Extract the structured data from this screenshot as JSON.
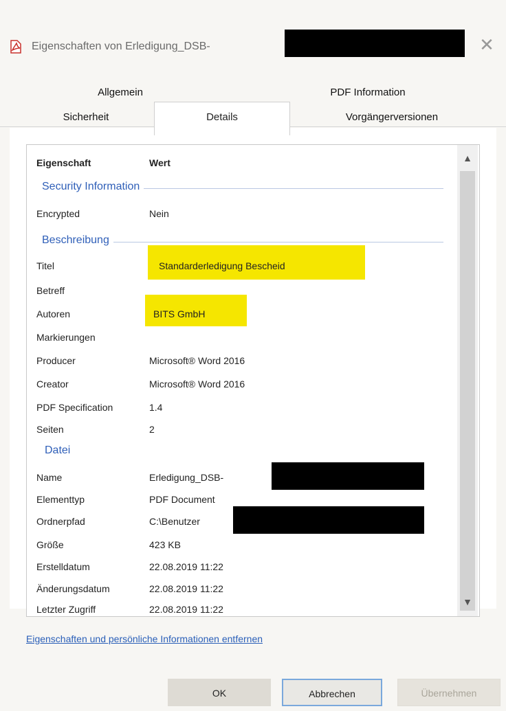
{
  "window": {
    "title": "Eigenschaften von Erledigung_DSB-",
    "close_glyph": "✕"
  },
  "tabs": {
    "row1": [
      "Allgemein",
      "PDF Information"
    ],
    "row2": [
      "Sicherheit",
      "Details",
      "Vorgängerversionen"
    ],
    "active": "Details"
  },
  "list": {
    "header": {
      "property": "Eigenschaft",
      "value": "Wert"
    },
    "groups": {
      "security": "Security Information",
      "description": "Beschreibung",
      "file": "Datei"
    },
    "rows": [
      {
        "property": "Encrypted",
        "value": "Nein"
      },
      {
        "property": "Titel",
        "value": "Standarderledigung Bescheid"
      },
      {
        "property": "Betreff",
        "value": ""
      },
      {
        "property": "Autoren",
        "value": "BITS GmbH"
      },
      {
        "property": "Markierungen",
        "value": ""
      },
      {
        "property": "Producer",
        "value": "Microsoft® Word 2016"
      },
      {
        "property": "Creator",
        "value": "Microsoft® Word 2016"
      },
      {
        "property": "PDF Specification",
        "value": "1.4"
      },
      {
        "property": "Seiten",
        "value": "2"
      },
      {
        "property": "Name",
        "value": "Erledigung_DSB-"
      },
      {
        "property": "Elementtyp",
        "value": "PDF Document"
      },
      {
        "property": "Ordnerpfad",
        "value": "C:\\Benutzer"
      },
      {
        "property": "Größe",
        "value": "423 KB"
      },
      {
        "property": "Erstelldatum",
        "value": "22.08.2019 11:22"
      },
      {
        "property": "Änderungsdatum",
        "value": "22.08.2019 11:22"
      },
      {
        "property": "Letzter Zugriff",
        "value": "22.08.2019 11:22"
      }
    ],
    "highlight_color": "#f5e600"
  },
  "link": {
    "label": "Eigenschaften und persönliche Informationen entfernen"
  },
  "buttons": {
    "ok": "OK",
    "cancel": "Abbrechen",
    "apply": "Übernehmen"
  },
  "colors": {
    "group_title": "#2f5fb8",
    "link": "#2a5fb8"
  }
}
